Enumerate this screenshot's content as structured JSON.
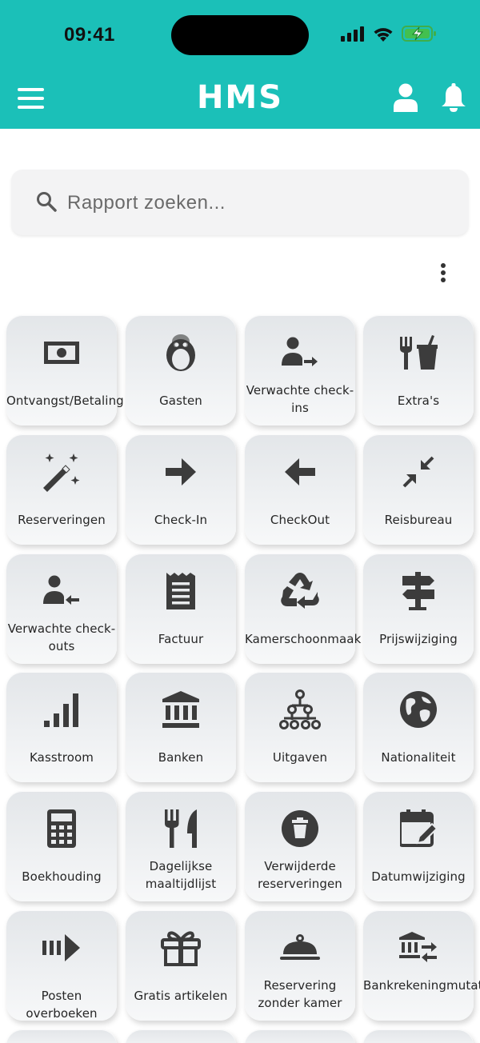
{
  "status_bar": {
    "time": "09:41"
  },
  "header": {
    "title": "HMS",
    "accent_color": "#1bc0b8",
    "icons": [
      "menu-icon",
      "user-icon",
      "bell-icon"
    ]
  },
  "search": {
    "placeholder": "Rapport zoeken..."
  },
  "tiles": [
    {
      "label": "Ontvangst/Betaling",
      "icon": "money-icon"
    },
    {
      "label": "Gasten",
      "icon": "penguin-icon"
    },
    {
      "label": "Verwachte check-ins",
      "icon": "user-arrow-right-icon"
    },
    {
      "label": "Extra's",
      "icon": "utensils-drink-icon"
    },
    {
      "label": "Reserveringen",
      "icon": "magic-wand-icon"
    },
    {
      "label": "Check-In",
      "icon": "arrow-right-icon"
    },
    {
      "label": "CheckOut",
      "icon": "arrow-left-icon"
    },
    {
      "label": "Reisbureau",
      "icon": "compress-arrows-icon"
    },
    {
      "label": "Verwachte check-outs",
      "icon": "user-arrow-left-icon"
    },
    {
      "label": "Factuur",
      "icon": "receipt-icon"
    },
    {
      "label": "Kamerschoonmaak",
      "icon": "recycle-icon"
    },
    {
      "label": "Prijswijziging",
      "icon": "signpost-icon"
    },
    {
      "label": "Kasstroom",
      "icon": "signal-bars-icon"
    },
    {
      "label": "Banken",
      "icon": "bank-icon"
    },
    {
      "label": "Uitgaven",
      "icon": "hierarchy-icon"
    },
    {
      "label": "Nationaliteit",
      "icon": "globe-icon"
    },
    {
      "label": "Boekhouding",
      "icon": "calculator-icon"
    },
    {
      "label": "Dagelijkse maaltijdlijst",
      "icon": "utensils-icon"
    },
    {
      "label": "Verwijderde reserveringen",
      "icon": "trash-circle-icon"
    },
    {
      "label": "Datumwijziging",
      "icon": "calendar-edit-icon"
    },
    {
      "label": "Posten overboeken",
      "icon": "transfer-items-icon"
    },
    {
      "label": "Gratis artikelen",
      "icon": "gift-icon"
    },
    {
      "label": "Reservering zonder kamer",
      "icon": "cloche-icon"
    },
    {
      "label": "Bankrekeningmutaties",
      "icon": "bank-transfer-icon"
    }
  ]
}
